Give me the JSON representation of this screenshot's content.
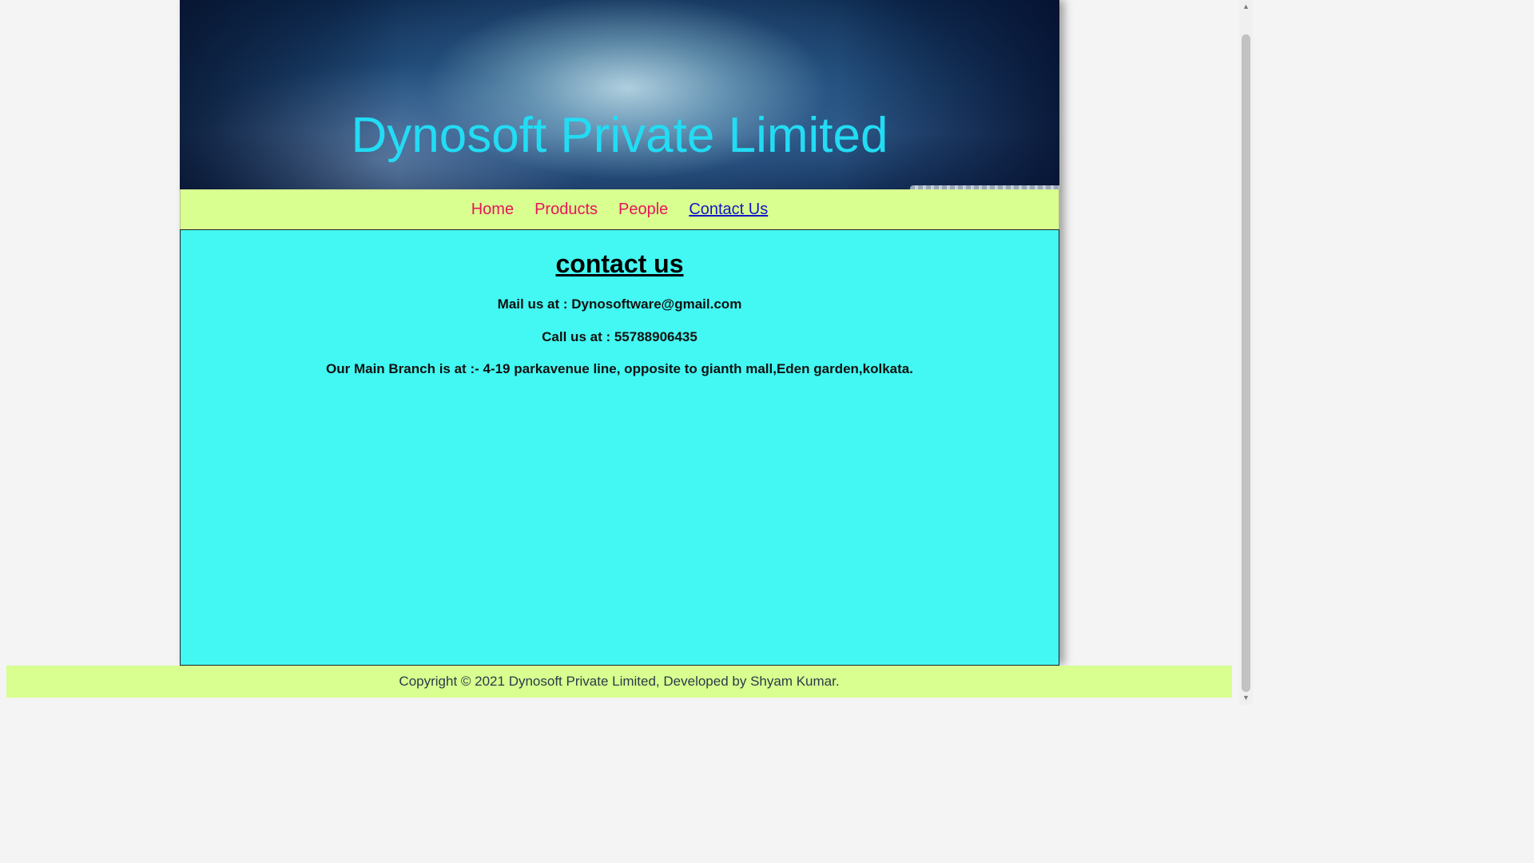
{
  "header": {
    "site_title": "Dynosoft Private Limited"
  },
  "nav": {
    "items": [
      {
        "label": "Home"
      },
      {
        "label": "Products"
      },
      {
        "label": "People"
      },
      {
        "label": "Contact Us"
      }
    ],
    "active": "Contact Us"
  },
  "content": {
    "heading": "contact us",
    "mail": "Mail us at : Dynosoftware@gmail.com",
    "call": "Call us at : 55788906435",
    "branch": "Our Main Branch is at :- 4-19 parkavenue line, opposite to gianth mall,Eden garden,kolkata."
  },
  "footer": {
    "copyright": "Copyright © 2021 Dynosoft Private Limited, Developed by Shyam Kumar."
  },
  "colors": {
    "title": "#22dcf4",
    "nav_bg": "#d8ff8f",
    "nav_link": "#e8145a",
    "nav_active": "#1414c8",
    "content_bg": "#43f8f2"
  },
  "icons": {
    "scroll_up": "triangle-up-icon",
    "scroll_down": "triangle-down-icon"
  }
}
